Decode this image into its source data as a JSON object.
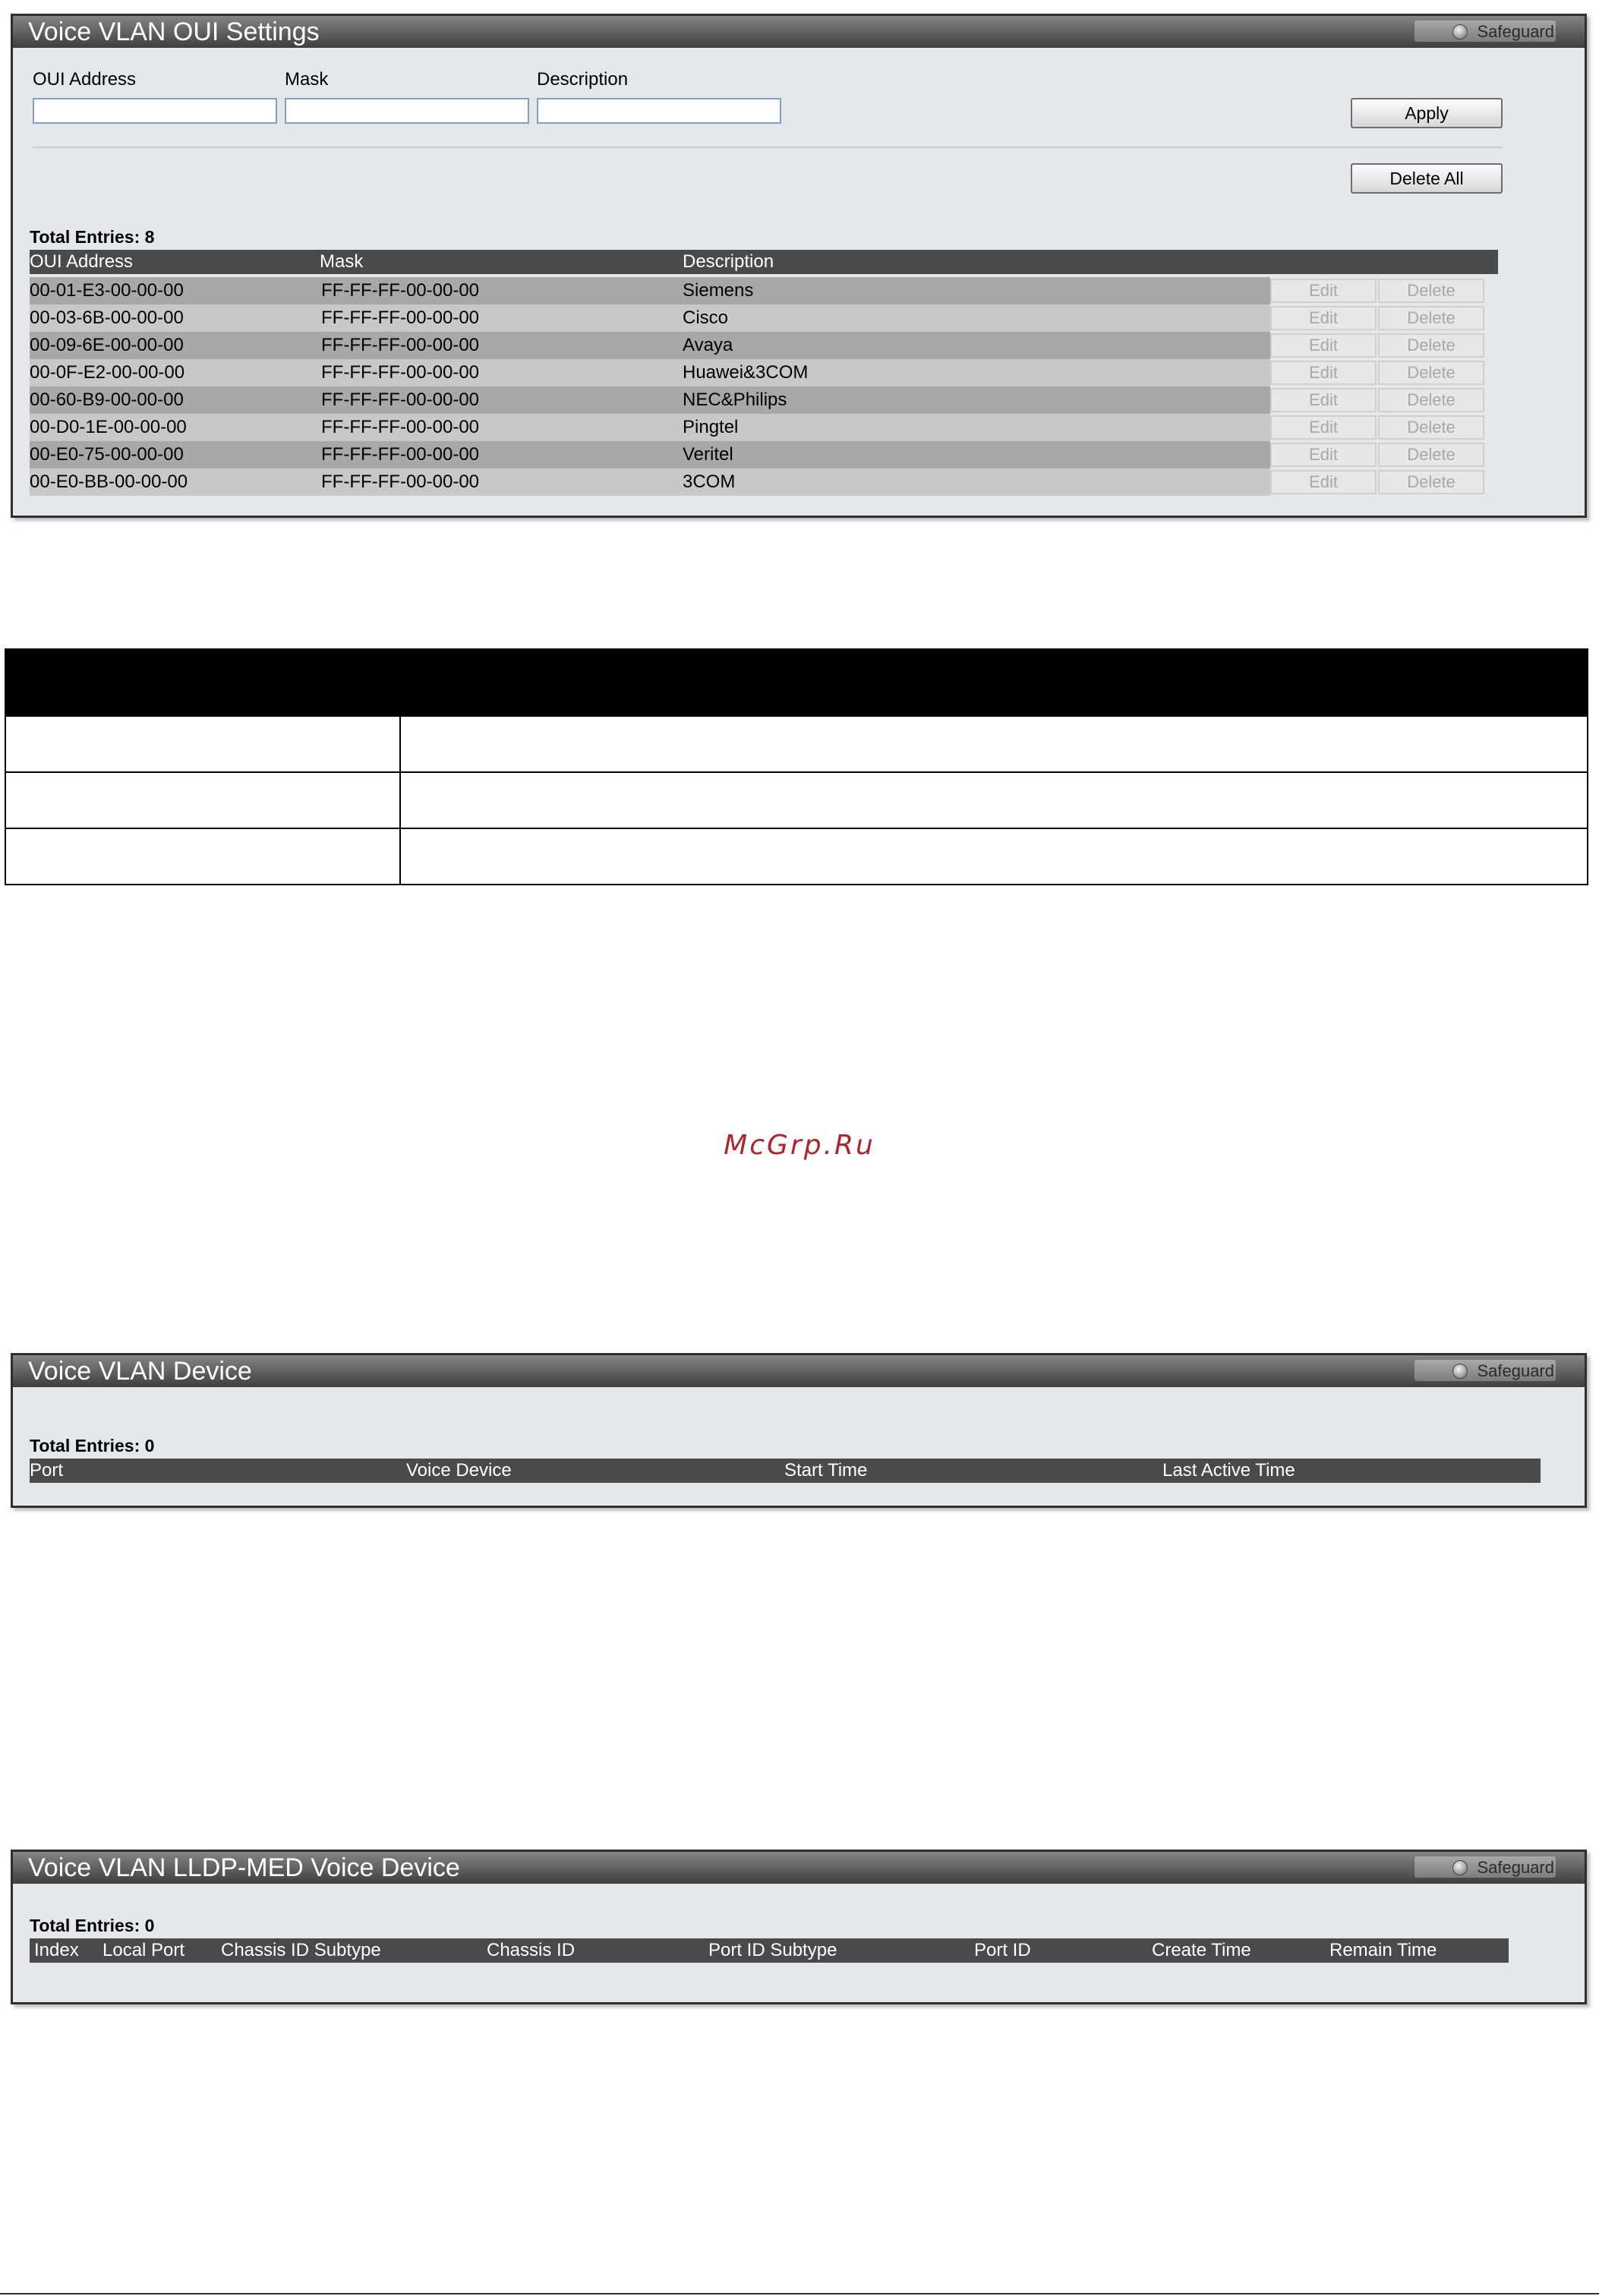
{
  "oui_panel": {
    "title": "Voice VLAN OUI Settings",
    "safeguard": "Safeguard",
    "labels": {
      "oui": "OUI Address",
      "mask": "Mask",
      "description": "Description"
    },
    "values": {
      "oui": "",
      "mask": "",
      "description": ""
    },
    "apply": "Apply",
    "delete_all": "Delete All",
    "total": "Total Entries: 8",
    "columns": [
      "OUI Address",
      "Mask",
      "Description"
    ],
    "edit_label": "Edit",
    "delete_label": "Delete",
    "rows": [
      {
        "oui": "00-01-E3-00-00-00",
        "mask": "FF-FF-FF-00-00-00",
        "desc": "Siemens"
      },
      {
        "oui": "00-03-6B-00-00-00",
        "mask": "FF-FF-FF-00-00-00",
        "desc": "Cisco"
      },
      {
        "oui": "00-09-6E-00-00-00",
        "mask": "FF-FF-FF-00-00-00",
        "desc": "Avaya"
      },
      {
        "oui": "00-0F-E2-00-00-00",
        "mask": "FF-FF-FF-00-00-00",
        "desc": "Huawei&3COM"
      },
      {
        "oui": "00-60-B9-00-00-00",
        "mask": "FF-FF-FF-00-00-00",
        "desc": "NEC&Philips"
      },
      {
        "oui": "00-D0-1E-00-00-00",
        "mask": "FF-FF-FF-00-00-00",
        "desc": "Pingtel"
      },
      {
        "oui": "00-E0-75-00-00-00",
        "mask": "FF-FF-FF-00-00-00",
        "desc": "Veritel"
      },
      {
        "oui": "00-E0-BB-00-00-00",
        "mask": "FF-FF-FF-00-00-00",
        "desc": "3COM"
      }
    ]
  },
  "watermark": "McGrp.Ru",
  "device_panel": {
    "title": "Voice VLAN Device",
    "safeguard": "Safeguard",
    "total": "Total Entries: 0",
    "columns": [
      "Port",
      "Voice Device",
      "Start Time",
      "Last Active Time"
    ]
  },
  "lldp_panel": {
    "title": "Voice VLAN LLDP-MED Voice Device",
    "safeguard": "Safeguard",
    "total": "Total Entries: 0",
    "columns": [
      "Index",
      "Local Port",
      "Chassis ID Subtype",
      "Chassis ID",
      "Port ID Subtype",
      "Port ID",
      "Create Time",
      "Remain Time"
    ]
  },
  "colors": {
    "panel_bg": "#e4e8ea",
    "header_bg": "#4a4a4a",
    "row_dark": "#a8a8a8",
    "row_light": "#c8c8c8",
    "watermark": "#b0242c"
  }
}
